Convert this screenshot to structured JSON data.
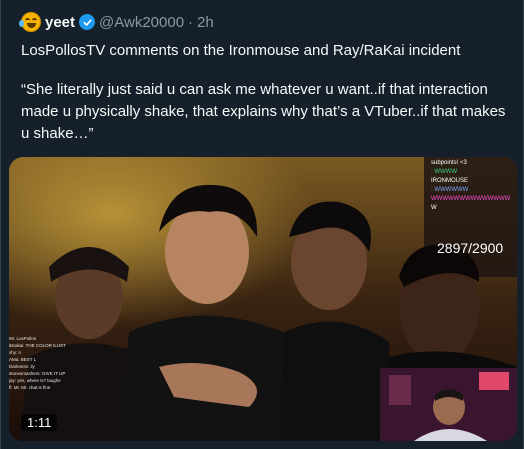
{
  "tweet": {
    "display_name": "yeet",
    "handle": "@Awk20000",
    "separator": "·",
    "time": "2h",
    "avatar_icon": "tears-of-joy-emoji-icon",
    "verified_icon": "verified-badge-icon",
    "text_line1": "LosPollosTV comments on the Ironmouse and Ray/RaKai incident",
    "quote": "“She literally just said u can ask me whatever u want..if that interaction made u physically shake, that explains why that’s a VTuber..if that makes u shake…”"
  },
  "media": {
    "viewer_count": "2897/2900",
    "duration": "1:11",
    "chat_lines": [
      "subpoints! <3",
      ": WWWW",
      "IRONMOUSE",
      ": WWWWWW",
      "WWWWWWWWWWWWWW",
      "W"
    ],
    "left_chat_lines": [
      "Mr. LosPollos",
      "itsrakai: THE COLOR ILUST",
      "shy: n",
      "AMa: BEST L",
      "Darkness: ily",
      "stonesmashers: GIVE IT UP",
      "jay: yes, where is? laughs",
      "fl: Mr. Mr. chat is fine"
    ],
    "colors": {
      "background": "#15202b",
      "accent": "#1d9bf0",
      "muted_text": "#8b98a5"
    }
  }
}
